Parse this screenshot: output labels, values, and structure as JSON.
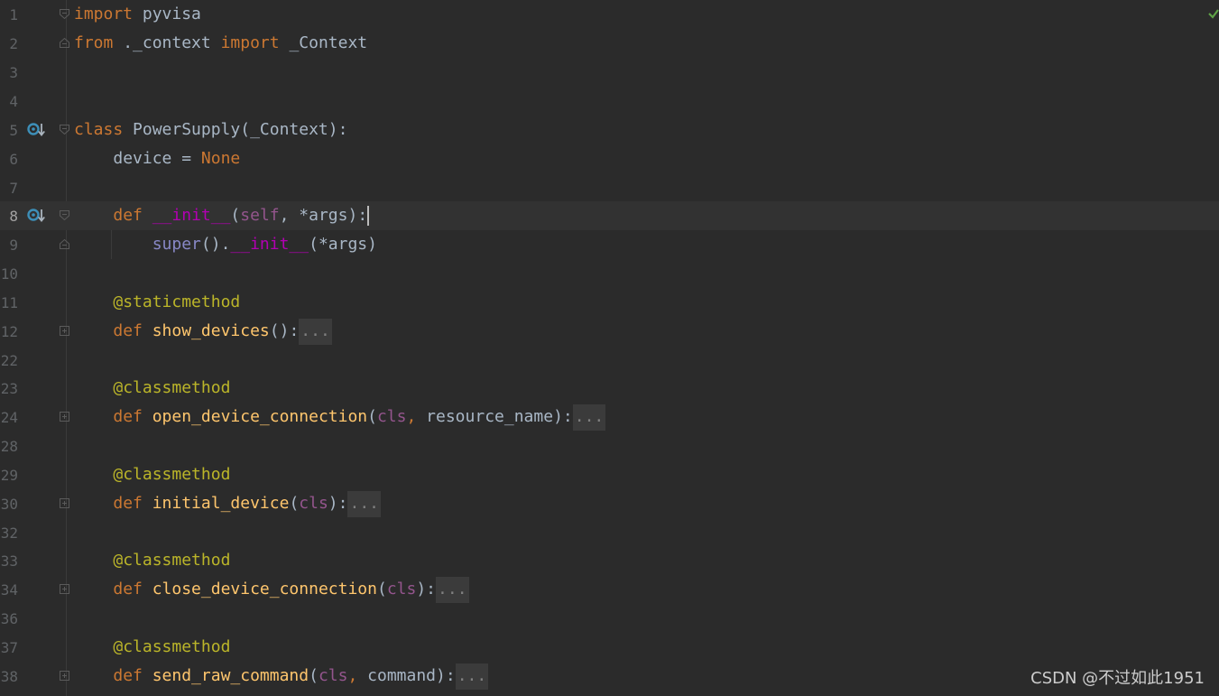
{
  "editor": {
    "lines": [
      {
        "num": "1"
      },
      {
        "num": "2"
      },
      {
        "num": "3"
      },
      {
        "num": "4"
      },
      {
        "num": "5"
      },
      {
        "num": "6"
      },
      {
        "num": "7"
      },
      {
        "num": "8"
      },
      {
        "num": "9"
      },
      {
        "num": "10"
      },
      {
        "num": "11"
      },
      {
        "num": "12"
      },
      {
        "num": "22"
      },
      {
        "num": "23"
      },
      {
        "num": "24"
      },
      {
        "num": "28"
      },
      {
        "num": "29"
      },
      {
        "num": "30"
      },
      {
        "num": "32"
      },
      {
        "num": "33"
      },
      {
        "num": "34"
      },
      {
        "num": "36"
      },
      {
        "num": "37"
      },
      {
        "num": "38"
      }
    ],
    "tokens": {
      "l1_kw": "import",
      "l1_rest": " pyvisa",
      "l2_kw1": "from",
      "l2_mid": " ._context ",
      "l2_kw2": "import",
      "l2_rest": " _Context",
      "l5_kw": "class",
      "l5_rest": " PowerSupply(_Context):",
      "l6_indent": "    ",
      "l6_a": "device = ",
      "l6_none": "None",
      "l8_indent": "    ",
      "l8_kw": "def",
      "l8_sp": " ",
      "l8_fn": "__init__",
      "l8_p1": "(",
      "l8_self": "self",
      "l8_p2": ", *args):",
      "l9_indent": "        ",
      "l9_super": "super",
      "l9_p1": "().",
      "l9_init": "__init__",
      "l9_p2": "(*args)",
      "l11_indent": "    ",
      "l11_deco": "@staticmethod",
      "l12_indent": "    ",
      "l12_kw": "def",
      "l12_fn": " show_devices",
      "l12_p": "():",
      "l12_fold": "...",
      "l23_indent": "    ",
      "l23_deco": "@classmethod",
      "l24_indent": "    ",
      "l24_kw": "def",
      "l24_fn": " open_device_connection",
      "l24_p1": "(",
      "l24_cls": "cls",
      "l24_p2": ", ",
      "l24_arg": "resource_name",
      "l24_p3": "):",
      "l24_fold": "...",
      "l29_indent": "    ",
      "l29_deco": "@classmethod",
      "l30_indent": "    ",
      "l30_kw": "def",
      "l30_fn": " initial_device",
      "l30_p1": "(",
      "l30_cls": "cls",
      "l30_p2": "):",
      "l30_fold": "...",
      "l33_indent": "    ",
      "l33_deco": "@classmethod",
      "l34_indent": "    ",
      "l34_kw": "def",
      "l34_fn": " close_device_connection",
      "l34_p1": "(",
      "l34_cls": "cls",
      "l34_p2": "):",
      "l34_fold": "...",
      "l37_indent": "    ",
      "l37_deco": "@classmethod",
      "l38_indent": "    ",
      "l38_kw": "def",
      "l38_fn": " send_raw_command",
      "l38_p1": "(",
      "l38_cls": "cls",
      "l38_p2": ", ",
      "l38_arg": "command",
      "l38_p3": "):",
      "l38_fold": "..."
    }
  },
  "watermark": "CSDN @不过如此1951",
  "icons": {
    "override_marker": "implemented-method-gutter-icon",
    "fold": "fold-toggle-icon",
    "status": "inspection-ok-check-icon"
  },
  "colors": {
    "background": "#2b2b2b",
    "keyword": "#cc7832",
    "function": "#ffc66d",
    "magic": "#b200b2",
    "self": "#94558d",
    "decorator": "#bbb529",
    "text": "#a9b7c6"
  }
}
